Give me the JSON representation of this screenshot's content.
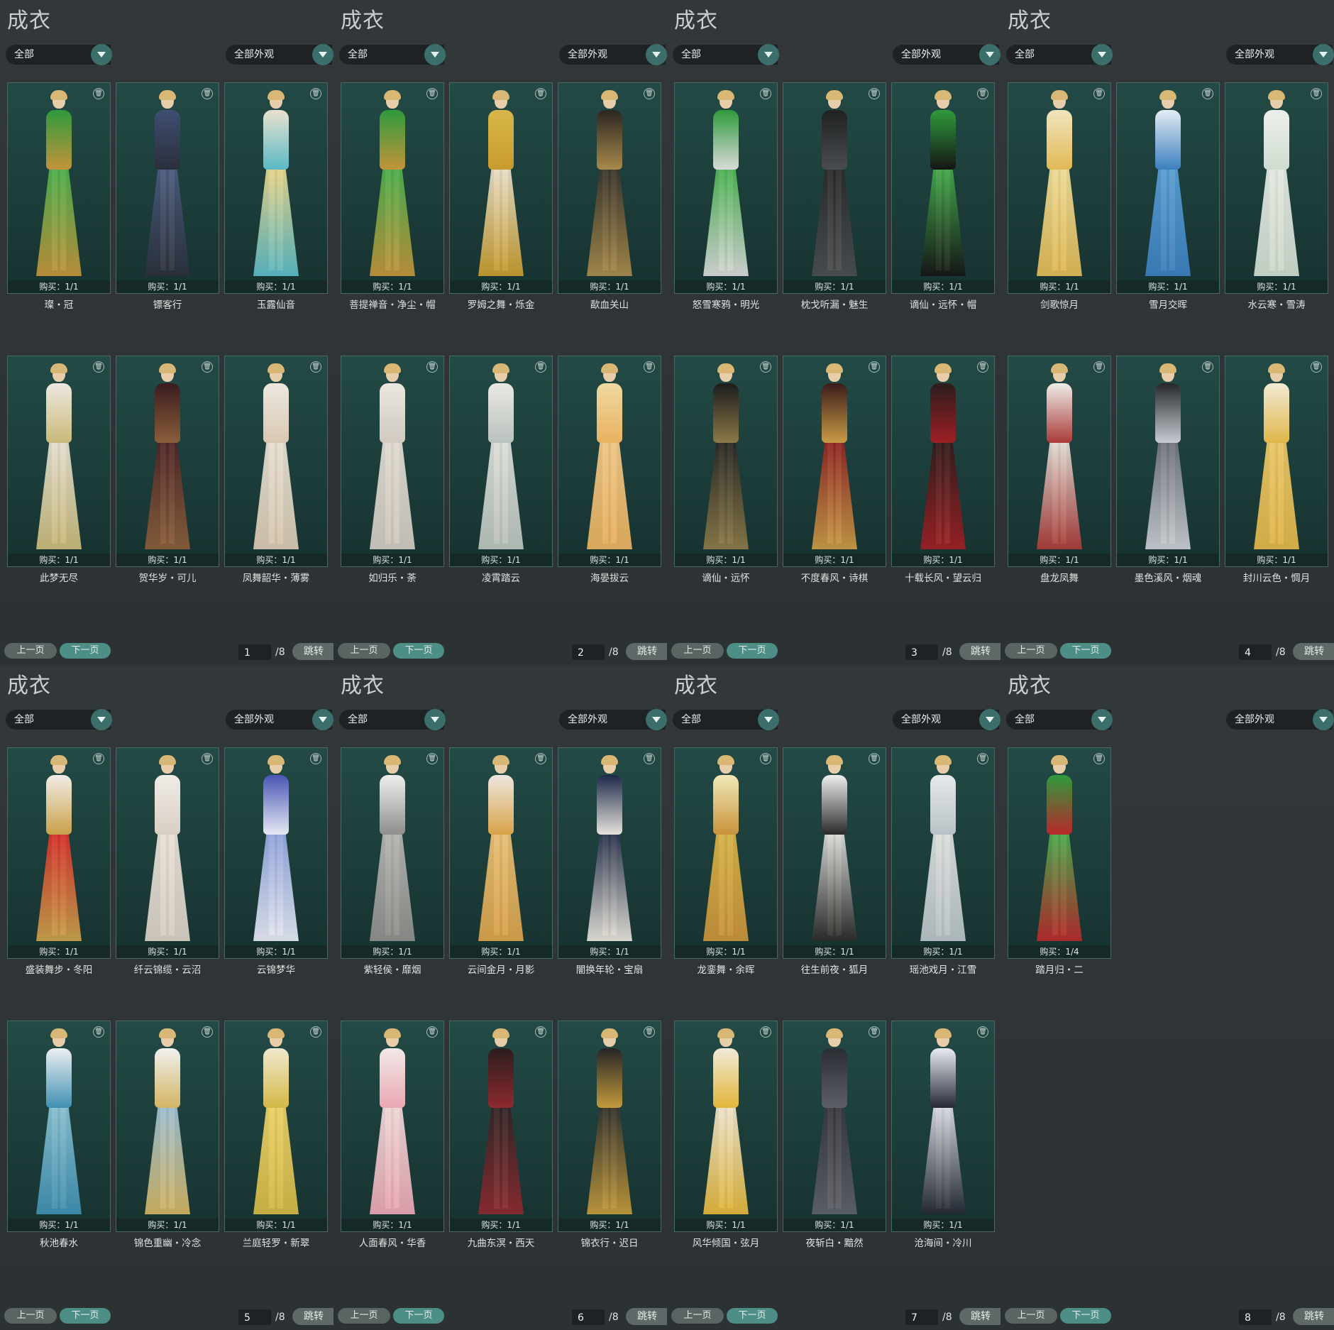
{
  "panels": [
    {
      "title": "成衣",
      "filter_left": "全部",
      "filter_right": "全部外观",
      "prev_label": "上一页",
      "next_label": "下一页",
      "page": "1",
      "total": "/8",
      "jump_label": "跳转",
      "items": [
        {
          "name": "璨・冠",
          "buy": "购买：1/1",
          "top": "#2f9a3c",
          "bottom": "#45b14e",
          "accent": "#c2933a"
        },
        {
          "name": "镖客行",
          "buy": "购买：1/1",
          "top": "#3f4e72",
          "bottom": "#4b5c83",
          "accent": "#2a2f3a"
        },
        {
          "name": "玉露仙音",
          "buy": "购买：1/1",
          "top": "#e9e2cf",
          "bottom": "#f0d88a",
          "accent": "#5ab9c5"
        },
        {
          "name": "此梦无尽",
          "buy": "购买：1/1",
          "top": "#ece8e0",
          "bottom": "#e6e2d6",
          "accent": "#c9b979"
        },
        {
          "name": "贺华岁・可儿",
          "buy": "购买：1/1",
          "top": "#3a1c20",
          "bottom": "#4a2126",
          "accent": "#8a5e3a"
        },
        {
          "name": "凤舞韶华・薄雾",
          "buy": "购买：1/1",
          "top": "#ece7df",
          "bottom": "#e9e3d7",
          "accent": "#d8c8b2"
        }
      ]
    },
    {
      "title": "成衣",
      "filter_left": "全部",
      "filter_right": "全部外观",
      "prev_label": "上一页",
      "next_label": "下一页",
      "page": "2",
      "total": "/8",
      "jump_label": "跳转",
      "items": [
        {
          "name": "菩提禅音・净尘・帽",
          "buy": "购买：1/1",
          "top": "#2f9a3c",
          "bottom": "#45b14e",
          "accent": "#c2933a"
        },
        {
          "name": "罗姆之舞・烁金",
          "buy": "购买：1/1",
          "top": "#d8b64a",
          "bottom": "#eae2d2",
          "accent": "#c79b2c"
        },
        {
          "name": "歃血关山",
          "buy": "购买：1/1",
          "top": "#2a2622",
          "bottom": "#33302b",
          "accent": "#a88a4b"
        },
        {
          "name": "如归乐・荼",
          "buy": "购买：1/1",
          "top": "#ebe7e0",
          "bottom": "#e3ded6",
          "accent": "#cfc9bf"
        },
        {
          "name": "凌霄踏云",
          "buy": "购买：1/1",
          "top": "#e9e8e3",
          "bottom": "#dfe2de",
          "accent": "#b9c2bd"
        },
        {
          "name": "海晏拔云",
          "buy": "购买：1/1",
          "top": "#efd9a2",
          "bottom": "#f2c98a",
          "accent": "#e8b15f"
        }
      ]
    },
    {
      "title": "成衣",
      "filter_left": "全部",
      "filter_right": "全部外观",
      "prev_label": "上一页",
      "next_label": "下一页",
      "page": "3",
      "total": "/8",
      "jump_label": "跳转",
      "items": [
        {
          "name": "怒雪寒鸦・明光",
          "buy": "购买：1/1",
          "top": "#2f9a3c",
          "bottom": "#45b14e",
          "accent": "#d9d9d9"
        },
        {
          "name": "枕戈听漏・魅生",
          "buy": "购买：1/1",
          "top": "#1f2122",
          "bottom": "#262829",
          "accent": "#4a4d50"
        },
        {
          "name": "谪仙・远怀・帽",
          "buy": "购买：1/1",
          "top": "#2f9a3c",
          "bottom": "#45b14e",
          "accent": "#151515"
        },
        {
          "name": "谪仙・远怀",
          "buy": "购买：1/1",
          "top": "#1c1c1d",
          "bottom": "#232324",
          "accent": "#8c7a48"
        },
        {
          "name": "不度春风・诗棋",
          "buy": "购买：1/1",
          "top": "#3a1b1b",
          "bottom": "#8c1e22",
          "accent": "#c99b45"
        },
        {
          "name": "十载长风・望云归",
          "buy": "购买：1/1",
          "top": "#2b1d1d",
          "bottom": "#2a1a1a",
          "accent": "#9d1f24"
        }
      ]
    },
    {
      "title": "成衣",
      "filter_left": "全部",
      "filter_right": "全部外观",
      "prev_label": "上一页",
      "next_label": "下一页",
      "page": "4",
      "total": "/8",
      "jump_label": "跳转",
      "items": [
        {
          "name": "剑歌惊月",
          "buy": "购买：1/1",
          "top": "#f1e5bf",
          "bottom": "#f0df9c",
          "accent": "#e1b955"
        },
        {
          "name": "雪月交晖",
          "buy": "购买：1/1",
          "top": "#e4ecf2",
          "bottom": "#5aa0d6",
          "accent": "#3b7fbf"
        },
        {
          "name": "水云寒・雪涛",
          "buy": "购买：1/1",
          "top": "#ecefe9",
          "bottom": "#e7ece6",
          "accent": "#cfdccf"
        },
        {
          "name": "盘龙凤舞",
          "buy": "购买：1/1",
          "top": "#eeede8",
          "bottom": "#e6e6df",
          "accent": "#a93a38"
        },
        {
          "name": "墨色溪风・烟魂",
          "buy": "购买：1/1",
          "top": "#25272b",
          "bottom": "#6b6f7a",
          "accent": "#c9cdd3"
        },
        {
          "name": "封川云色・惆月",
          "buy": "购买：1/1",
          "top": "#f1ead3",
          "bottom": "#ecc86a",
          "accent": "#e1b64a"
        }
      ]
    },
    {
      "title": "成衣",
      "filter_left": "全部",
      "filter_right": "全部外观",
      "prev_label": "上一页",
      "next_label": "下一页",
      "page": "5",
      "total": "/8",
      "jump_label": "跳转",
      "items": [
        {
          "name": "盛装舞步・冬阳",
          "buy": "购买：1/1",
          "top": "#f1ece6",
          "bottom": "#d62b2b",
          "accent": "#c9a14a"
        },
        {
          "name": "纤云锦缆・云沼",
          "buy": "购买：1/1",
          "top": "#efebe6",
          "bottom": "#ebe4dc",
          "accent": "#d8cfc4"
        },
        {
          "name": "云锦梦华",
          "buy": "购买：1/1",
          "top": "#4a56b4",
          "bottom": "#8fa3e0",
          "accent": "#e6e9f4"
        },
        {
          "name": "秋池春水",
          "buy": "购买：1/1",
          "top": "#edf0f2",
          "bottom": "#8cc3d5",
          "accent": "#3f8fb1"
        },
        {
          "name": "锦色重幽・冷念",
          "buy": "购买：1/1",
          "top": "#f0f1ef",
          "bottom": "#9cc0da",
          "accent": "#d2b462"
        },
        {
          "name": "兰庭轻罗・新翠",
          "buy": "购买：1/1",
          "top": "#efe9cf",
          "bottom": "#eed46a",
          "accent": "#d4b846"
        }
      ]
    },
    {
      "title": "成衣",
      "filter_left": "全部",
      "filter_right": "全部外观",
      "prev_label": "上一页",
      "next_label": "下一页",
      "page": "6",
      "total": "/8",
      "jump_label": "跳转",
      "items": [
        {
          "name": "紫轻侯・靡烟",
          "buy": "购买：1/1",
          "top": "#eeeeec",
          "bottom": "#b8b8b6",
          "accent": "#8e8e8c"
        },
        {
          "name": "云间金月・月影",
          "buy": "购买：1/1",
          "top": "#ece7df",
          "bottom": "#e9c27a",
          "accent": "#d9a24a"
        },
        {
          "name": "闇换年轮・宝扇",
          "buy": "购买：1/1",
          "top": "#1d2a4a",
          "bottom": "#222d48",
          "accent": "#e7e3dc"
        },
        {
          "name": "人面春风・华香",
          "buy": "购买：1/1",
          "top": "#f0e9e6",
          "bottom": "#f1dcdc",
          "accent": "#e9a6b3"
        },
        {
          "name": "九曲东溟・西天",
          "buy": "购买：1/1",
          "top": "#2a1d1f",
          "bottom": "#2b2325",
          "accent": "#8d2a2f"
        },
        {
          "name": "锦衣行・迟日",
          "buy": "购买：1/1",
          "top": "#232526",
          "bottom": "#2c2d2d",
          "accent": "#c49a3c"
        }
      ]
    },
    {
      "title": "成衣",
      "filter_left": "全部",
      "filter_right": "全部外观",
      "prev_label": "上一页",
      "next_label": "下一页",
      "page": "7",
      "total": "/8",
      "jump_label": "跳转",
      "items": [
        {
          "name": "龙銮舞・余晖",
          "buy": "购买：1/1",
          "top": "#f0e9b8",
          "bottom": "#d9b548",
          "accent": "#c8923a"
        },
        {
          "name": "往生前夜・狐月",
          "buy": "购买：1/1",
          "top": "#eeeeee",
          "bottom": "#e5e5e5",
          "accent": "#2a2a2a"
        },
        {
          "name": "瑶池戏月・江雪",
          "buy": "购买：1/1",
          "top": "#e6e9ea",
          "bottom": "#dfe3e4",
          "accent": "#b8c2c6"
        },
        {
          "name": "风华倾国・弦月",
          "buy": "购买：1/1",
          "top": "#f0ead7",
          "bottom": "#efe8d6",
          "accent": "#e2b53a"
        },
        {
          "name": "夜斩白・黯然",
          "buy": "购买：1/1",
          "top": "#2b2d33",
          "bottom": "#34363c",
          "accent": "#5d606a"
        },
        {
          "name": "沧海间・冷川",
          "buy": "购买：1/1",
          "top": "#e9ebf4",
          "bottom": "#e3e5f0",
          "accent": "#242833"
        }
      ]
    },
    {
      "title": "成衣",
      "filter_left": "全部",
      "filter_right": "全部外观",
      "prev_label": "上一页",
      "next_label": "下一页",
      "page": "8",
      "total": "/8",
      "jump_label": "跳转",
      "items": [
        {
          "name": "踏月归・二",
          "buy": "购买：1/4",
          "top": "#2f9a3c",
          "bottom": "#45b14e",
          "accent": "#b7282a"
        }
      ]
    }
  ]
}
